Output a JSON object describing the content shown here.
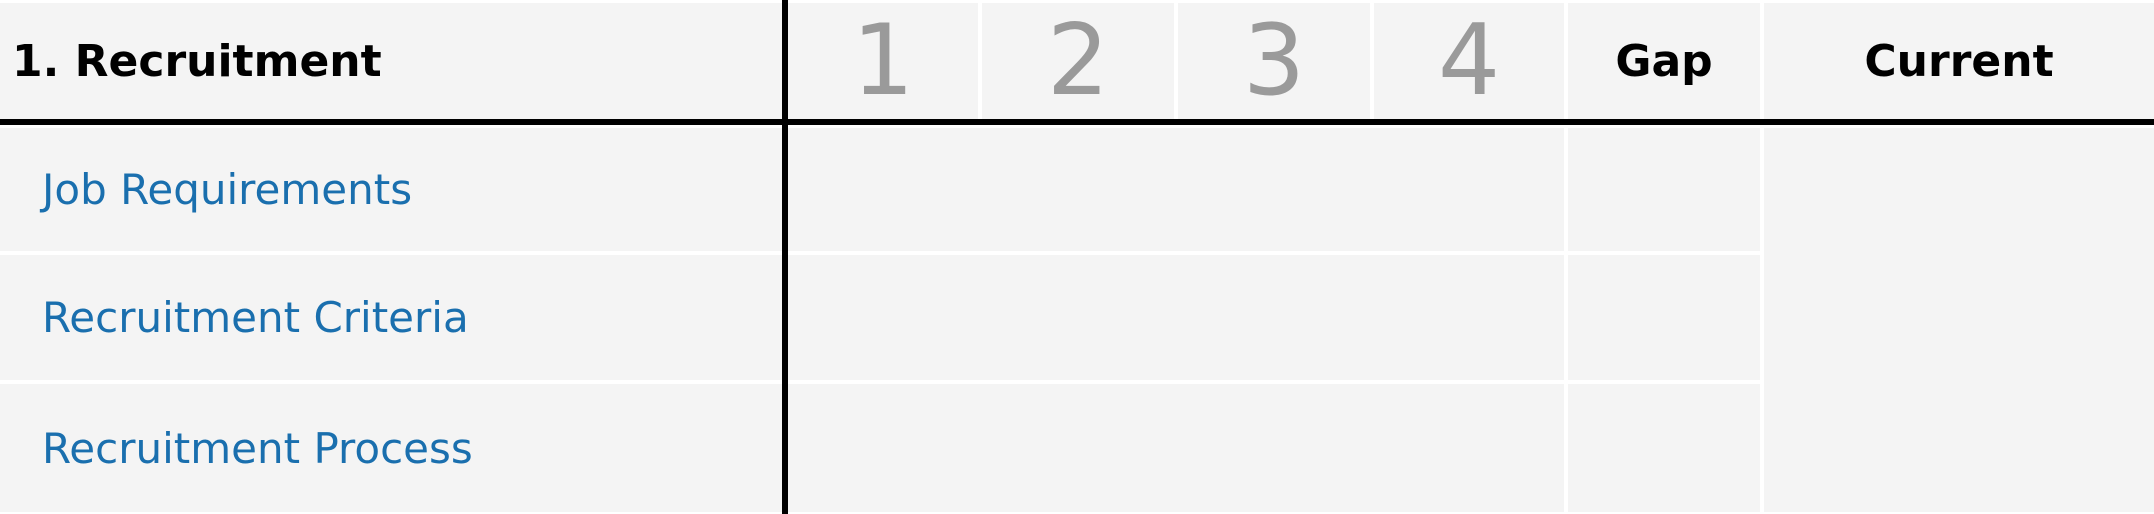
{
  "header": {
    "section_title": "1. Recruitment",
    "levels": [
      "1",
      "2",
      "3",
      "4"
    ],
    "gap_label": "Gap",
    "current_label": "Current"
  },
  "rows": [
    {
      "label": "Job Requirements"
    },
    {
      "label": "Recruitment Criteria"
    },
    {
      "label": "Recruitment Process"
    }
  ],
  "colors": {
    "cell_bg": "#f4f4f4",
    "row_label": "#1a6fae",
    "level_number": "#9a9a9a",
    "rule": "#000000"
  }
}
